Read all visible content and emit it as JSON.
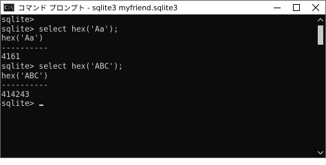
{
  "window": {
    "title": "コマンド プロンプト - sqlite3  myfriend.sqlite3",
    "icon": "C:\\",
    "controls": [
      "minimize",
      "maximize",
      "close"
    ]
  },
  "console": {
    "lines": [
      "sqlite>",
      "sqlite> select hex('Aa');",
      "hex('Aa')",
      "----------",
      "4161",
      "sqlite> select hex('ABC');",
      "hex('ABC')",
      "----------",
      "414243",
      "sqlite> "
    ]
  }
}
